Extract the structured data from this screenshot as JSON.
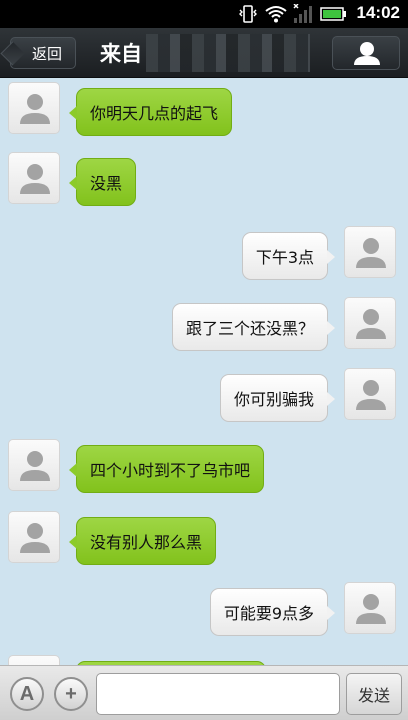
{
  "status_bar": {
    "time": "14:02"
  },
  "header": {
    "back_label": "返回",
    "title": "来自"
  },
  "messages": [
    {
      "side": "left",
      "text": "你明天几点的起飞"
    },
    {
      "side": "left",
      "text": "没黑"
    },
    {
      "side": "right",
      "text": "下午3点"
    },
    {
      "side": "right",
      "text": "跟了三个还没黑？"
    },
    {
      "side": "right",
      "text": "你可别骗我"
    },
    {
      "side": "left",
      "text": "四个小时到不了乌市吧"
    },
    {
      "side": "left",
      "text": "没有别人那么黑"
    },
    {
      "side": "right",
      "text": "可能要9点多"
    },
    {
      "side": "left",
      "text": ""
    }
  ],
  "input_bar": {
    "font_button": "A",
    "add_button": "+",
    "input_value": "",
    "send_label": "发送"
  },
  "colors": {
    "incoming_bubble": "#8ccb2a",
    "outgoing_bubble": "#f2f2f2",
    "chat_background": "#cfe3ef",
    "header": "#23272b"
  }
}
